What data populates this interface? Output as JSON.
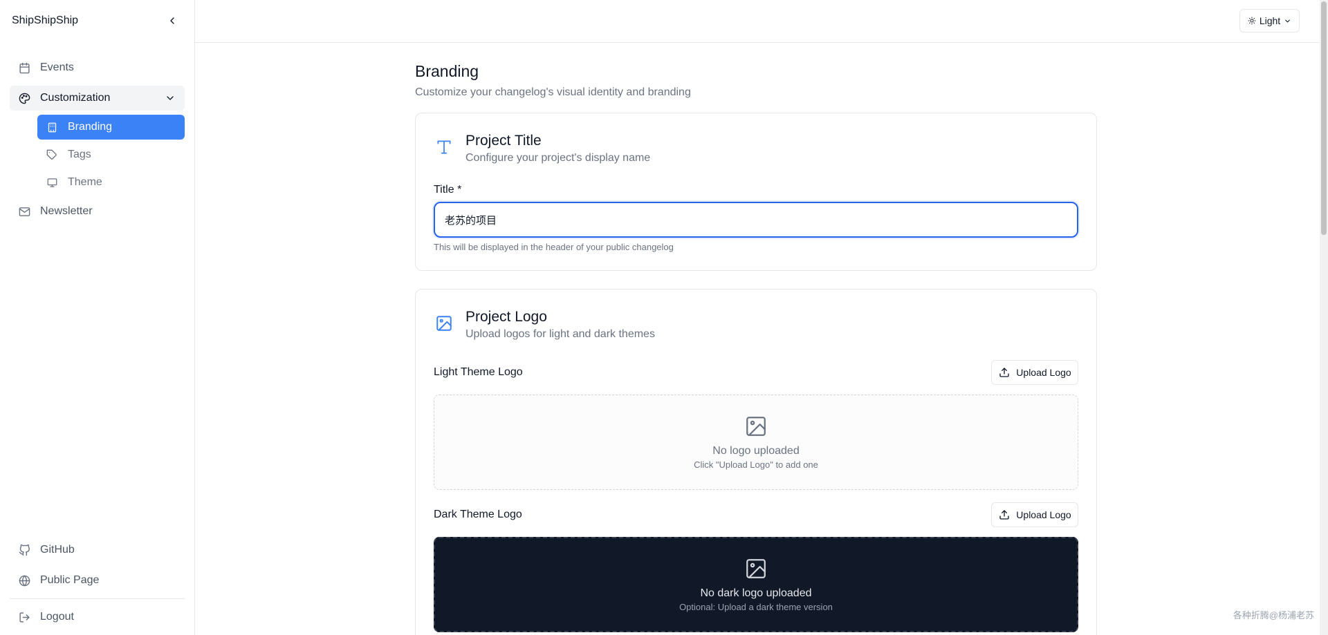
{
  "app": {
    "name": "ShipShipShip"
  },
  "sidebar": {
    "items": [
      {
        "label": "Events",
        "icon": "calendar-icon"
      },
      {
        "label": "Customization",
        "icon": "palette-icon",
        "expanded": true,
        "children": [
          {
            "label": "Branding",
            "icon": "building-icon",
            "active": true
          },
          {
            "label": "Tags",
            "icon": "tag-icon"
          },
          {
            "label": "Theme",
            "icon": "monitor-icon"
          }
        ]
      },
      {
        "label": "Newsletter",
        "icon": "mail-icon"
      }
    ],
    "bottom": [
      {
        "label": "GitHub",
        "icon": "github-icon"
      },
      {
        "label": "Public Page",
        "icon": "globe-icon"
      },
      {
        "label": "Logout",
        "icon": "logout-icon"
      }
    ]
  },
  "topbar": {
    "theme_label": "Light"
  },
  "page": {
    "title": "Branding",
    "subtitle": "Customize your changelog's visual identity and branding"
  },
  "project_title_card": {
    "title": "Project Title",
    "subtitle": "Configure your project's display name",
    "field_label": "Title *",
    "field_value": "老苏的项目",
    "help": "This will be displayed in the header of your public changelog"
  },
  "project_logo_card": {
    "title": "Project Logo",
    "subtitle": "Upload logos for light and dark themes",
    "light": {
      "label": "Light Theme Logo",
      "button": "Upload Logo",
      "empty_title": "No logo uploaded",
      "empty_sub": "Click \"Upload Logo\" to add one"
    },
    "dark": {
      "label": "Dark Theme Logo",
      "button": "Upload Logo",
      "empty_title": "No dark logo uploaded",
      "empty_sub": "Optional: Upload a dark theme version"
    }
  },
  "watermark": "各种折腾@杨浦老苏",
  "colors": {
    "accent": "#3b82f6",
    "focus": "#2563eb",
    "dark_bg": "#111827"
  }
}
